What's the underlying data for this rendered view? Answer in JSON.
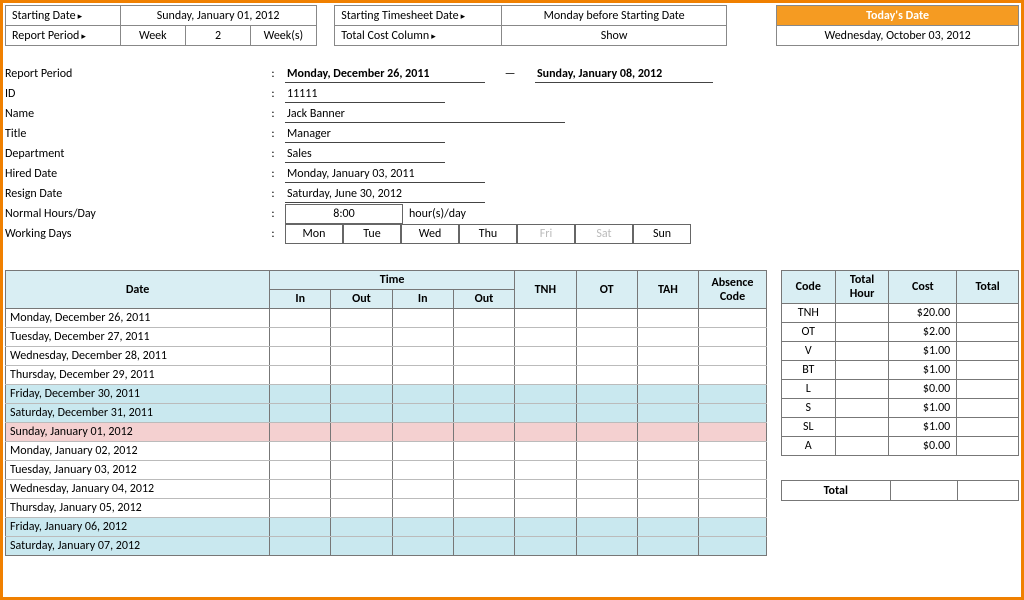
{
  "config": {
    "starting_date_lbl": "Starting Date",
    "starting_date_val": "Sunday, January 01, 2012",
    "starting_ts_lbl": "Starting Timesheet Date",
    "starting_ts_val": "Monday before Starting Date",
    "today_lbl": "Today's Date",
    "today_val": "Wednesday, October 03, 2012",
    "report_period_lbl": "Report Period",
    "week_lbl": "Week",
    "week_num": "2",
    "week_unit": "Week(s)",
    "total_cost_lbl": "Total Cost Column",
    "total_cost_val": "Show"
  },
  "info": {
    "report_period": {
      "lbl": "Report Period",
      "from": "Monday, December 26, 2011",
      "to": "Sunday, January 08, 2012"
    },
    "id": {
      "lbl": "ID",
      "val": "11111"
    },
    "name": {
      "lbl": "Name",
      "val": "Jack Banner"
    },
    "title": {
      "lbl": "Title",
      "val": "Manager"
    },
    "department": {
      "lbl": "Department",
      "val": "Sales"
    },
    "hired": {
      "lbl": "Hired Date",
      "val": "Monday, January 03, 2011"
    },
    "resign": {
      "lbl": "Resign Date",
      "val": "Saturday, June 30, 2012"
    },
    "normal": {
      "lbl": "Normal Hours/Day",
      "val": "8:00",
      "unit": "hour(s)/day"
    },
    "working": {
      "lbl": "Working Days"
    },
    "days": [
      "Mon",
      "Tue",
      "Wed",
      "Thu",
      "Fri",
      "Sat",
      "Sun"
    ],
    "days_on": [
      true,
      true,
      true,
      true,
      false,
      false,
      true
    ]
  },
  "sheet": {
    "headers": {
      "date": "Date",
      "time": "Time",
      "in": "In",
      "out": "Out",
      "tnh": "TNH",
      "ot": "OT",
      "tah": "TAH",
      "abs": "Absence Code"
    },
    "rows": [
      {
        "date": "Monday, December 26, 2011",
        "cls": ""
      },
      {
        "date": "Tuesday, December 27, 2011",
        "cls": ""
      },
      {
        "date": "Wednesday, December 28, 2011",
        "cls": ""
      },
      {
        "date": "Thursday, December 29, 2011",
        "cls": ""
      },
      {
        "date": "Friday, December 30, 2011",
        "cls": "weekend"
      },
      {
        "date": "Saturday, December 31, 2011",
        "cls": "weekend"
      },
      {
        "date": "Sunday, January 01, 2012",
        "cls": "sunday"
      },
      {
        "date": "Monday, January 02, 2012",
        "cls": ""
      },
      {
        "date": "Tuesday, January 03, 2012",
        "cls": ""
      },
      {
        "date": "Wednesday, January 04, 2012",
        "cls": ""
      },
      {
        "date": "Thursday, January 05, 2012",
        "cls": ""
      },
      {
        "date": "Friday, January 06, 2012",
        "cls": "weekend"
      },
      {
        "date": "Saturday, January 07, 2012",
        "cls": "weekend"
      }
    ]
  },
  "codes": {
    "headers": {
      "code": "Code",
      "hour": "Total Hour",
      "cost": "Cost",
      "total": "Total"
    },
    "rows": [
      {
        "code": "TNH",
        "cost": "$20.00"
      },
      {
        "code": "OT",
        "cost": "$2.00"
      },
      {
        "code": "V",
        "cost": "$1.00"
      },
      {
        "code": "BT",
        "cost": "$1.00"
      },
      {
        "code": "L",
        "cost": "$0.00"
      },
      {
        "code": "S",
        "cost": "$1.00"
      },
      {
        "code": "SL",
        "cost": "$1.00"
      },
      {
        "code": "A",
        "cost": "$0.00"
      }
    ],
    "total_lbl": "Total"
  }
}
